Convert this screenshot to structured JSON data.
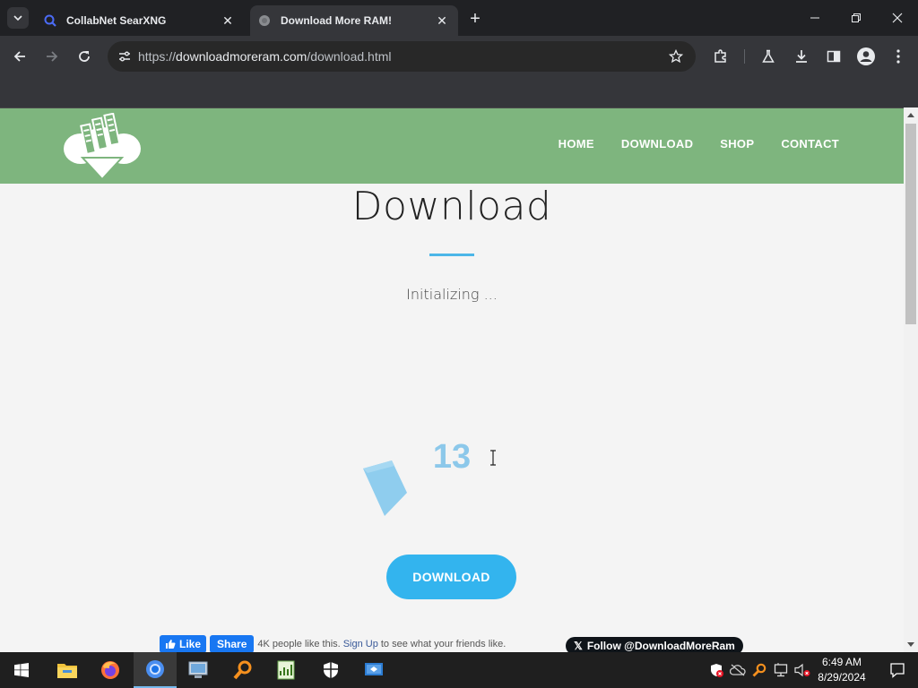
{
  "browser": {
    "tabs": [
      {
        "title": "CollabNet SearXNG",
        "favicon": "search-icon",
        "active": false
      },
      {
        "title": "Download More RAM!",
        "favicon": "globe-icon",
        "active": true
      }
    ],
    "url_prefix": "https://",
    "url_host": "downloadmoreram.com",
    "url_path": "/download.html"
  },
  "site": {
    "nav": [
      "HOME",
      "DOWNLOAD",
      "SHOP",
      "CONTACT"
    ],
    "colors": {
      "header": "#7eb57e",
      "accent": "#33b4ee"
    }
  },
  "main": {
    "title": "Download",
    "status": "Initializing ...",
    "countdown": "13",
    "download_button": "DOWNLOAD"
  },
  "social": {
    "fb_like": "Like",
    "fb_share": "Share",
    "fb_count_text": "4K people like this.",
    "fb_signup": "Sign Up",
    "fb_suffix": "to see what your friends like.",
    "x_follow": "Follow @DownloadMoreRam"
  },
  "taskbar": {
    "apps": [
      "windows-start-icon",
      "file-explorer-icon",
      "firefox-icon",
      "chrome-icon",
      "network-app-icon",
      "magnifier-app-icon",
      "spreadsheet-app-icon",
      "security-shield-icon",
      "remote-desktop-icon"
    ],
    "time": "6:49 AM",
    "date": "8/29/2024"
  }
}
